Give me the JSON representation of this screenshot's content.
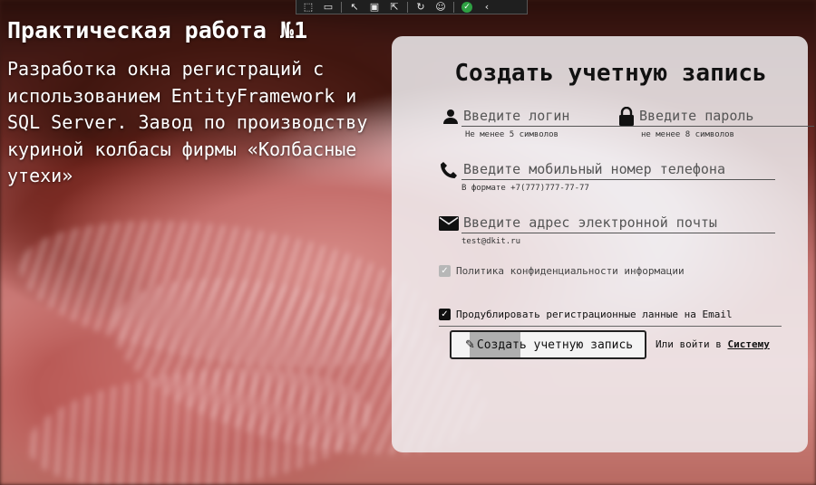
{
  "toolbar": {
    "icons": [
      "select-tool-icon",
      "camera-icon",
      "pointer-icon",
      "frame-icon",
      "pointer-select-icon",
      "hot-reload-icon",
      "accessibility-icon",
      "check-icon",
      "collapse-icon"
    ]
  },
  "left": {
    "title": "Практическая работа №1",
    "description": "Разработка окна регистраций с использованием EntityFramework и SQL Server. Завод по производству куриной колбасы фирмы «Колбасные утехи»"
  },
  "form": {
    "title": "Создать учетную запись",
    "login": {
      "placeholder": "Введите логин",
      "hint": "Не менее 5 символов"
    },
    "password": {
      "placeholder": "Введите пароль",
      "hint": "не менее 8 символов"
    },
    "phone": {
      "placeholder": "Введите мобильный номер телефона",
      "hint": "В формате +7(777)777-77-77"
    },
    "email": {
      "placeholder": "Введите адрес электронной почты",
      "hint": "test@dkit.ru"
    },
    "privacy_label": "Политика конфиденциальности информации",
    "privacy_checked": true,
    "duplicate_label": "Продублировать регистрационные ланные на Email",
    "duplicate_checked": true,
    "create_button": "Создать учетную запись",
    "login_prefix": "Или войти в",
    "login_link": "Систему"
  },
  "colors": {
    "panel": "#f0eef0",
    "accent": "#111111"
  }
}
